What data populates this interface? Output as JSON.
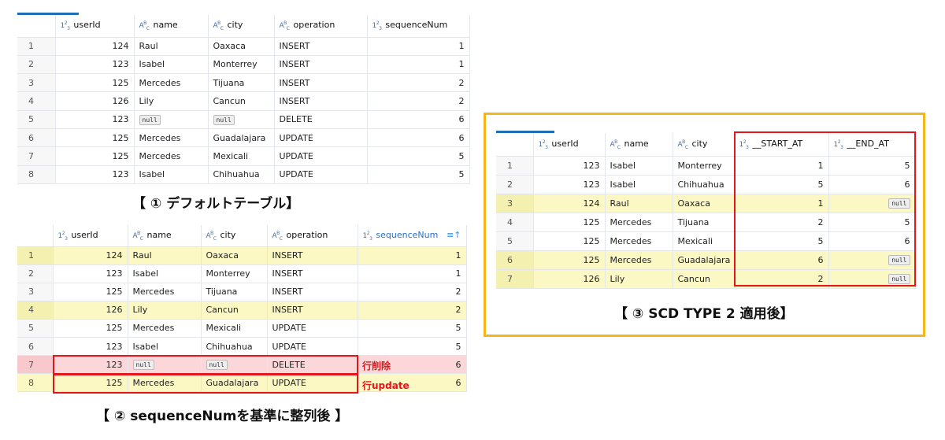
{
  "table1": {
    "columns": [
      "userId",
      "name",
      "city",
      "operation",
      "sequenceNum"
    ],
    "rows": [
      [
        "1",
        "124",
        "Raul",
        "Oaxaca",
        "INSERT",
        "1"
      ],
      [
        "2",
        "123",
        "Isabel",
        "Monterrey",
        "INSERT",
        "1"
      ],
      [
        "3",
        "125",
        "Mercedes",
        "Tijuana",
        "INSERT",
        "2"
      ],
      [
        "4",
        "126",
        "Lily",
        "Cancun",
        "INSERT",
        "2"
      ],
      [
        "5",
        "123",
        "null",
        "null",
        "DELETE",
        "6"
      ],
      [
        "6",
        "125",
        "Mercedes",
        "Guadalajara",
        "UPDATE",
        "6"
      ],
      [
        "7",
        "125",
        "Mercedes",
        "Mexicali",
        "UPDATE",
        "5"
      ],
      [
        "8",
        "123",
        "Isabel",
        "Chihuahua",
        "UPDATE",
        "5"
      ]
    ]
  },
  "caption1": "【 ① デフォルトテーブル】",
  "table2": {
    "columns": [
      "userId",
      "name",
      "city",
      "operation",
      "sequenceNum"
    ],
    "rows": [
      [
        "1",
        "124",
        "Raul",
        "Oaxaca",
        "INSERT",
        "1"
      ],
      [
        "2",
        "123",
        "Isabel",
        "Monterrey",
        "INSERT",
        "1"
      ],
      [
        "3",
        "125",
        "Mercedes",
        "Tijuana",
        "INSERT",
        "2"
      ],
      [
        "4",
        "126",
        "Lily",
        "Cancun",
        "INSERT",
        "2"
      ],
      [
        "5",
        "125",
        "Mercedes",
        "Mexicali",
        "UPDATE",
        "5"
      ],
      [
        "6",
        "123",
        "Isabel",
        "Chihuahua",
        "UPDATE",
        "5"
      ],
      [
        "7",
        "123",
        "null",
        "null",
        "DELETE",
        "6"
      ],
      [
        "8",
        "125",
        "Mercedes",
        "Guadalajara",
        "UPDATE",
        "6"
      ]
    ]
  },
  "annotations": {
    "delete_label": "行削除",
    "update_label": "行update"
  },
  "caption2": "【 ② sequenceNumを基準に整列後 】",
  "table3": {
    "columns": [
      "userId",
      "name",
      "city",
      "__START_AT",
      "__END_AT"
    ],
    "rows": [
      [
        "1",
        "123",
        "Isabel",
        "Monterrey",
        "1",
        "5"
      ],
      [
        "2",
        "123",
        "Isabel",
        "Chihuahua",
        "5",
        "6"
      ],
      [
        "3",
        "124",
        "Raul",
        "Oaxaca",
        "1",
        "null"
      ],
      [
        "4",
        "125",
        "Mercedes",
        "Tijuana",
        "2",
        "5"
      ],
      [
        "5",
        "125",
        "Mercedes",
        "Mexicali",
        "5",
        "6"
      ],
      [
        "6",
        "125",
        "Mercedes",
        "Guadalajara",
        "6",
        "null"
      ],
      [
        "7",
        "126",
        "Lily",
        "Cancun",
        "2",
        "null"
      ]
    ]
  },
  "caption3": "【 ③ SCD TYPE 2 適用後】",
  "colors": {
    "highlight": "#fbf8c4",
    "delete_row": "#fcd7d9",
    "red": "#e4161b",
    "frame": "#f4b61a",
    "tab_accent": "#1e6fb8"
  }
}
